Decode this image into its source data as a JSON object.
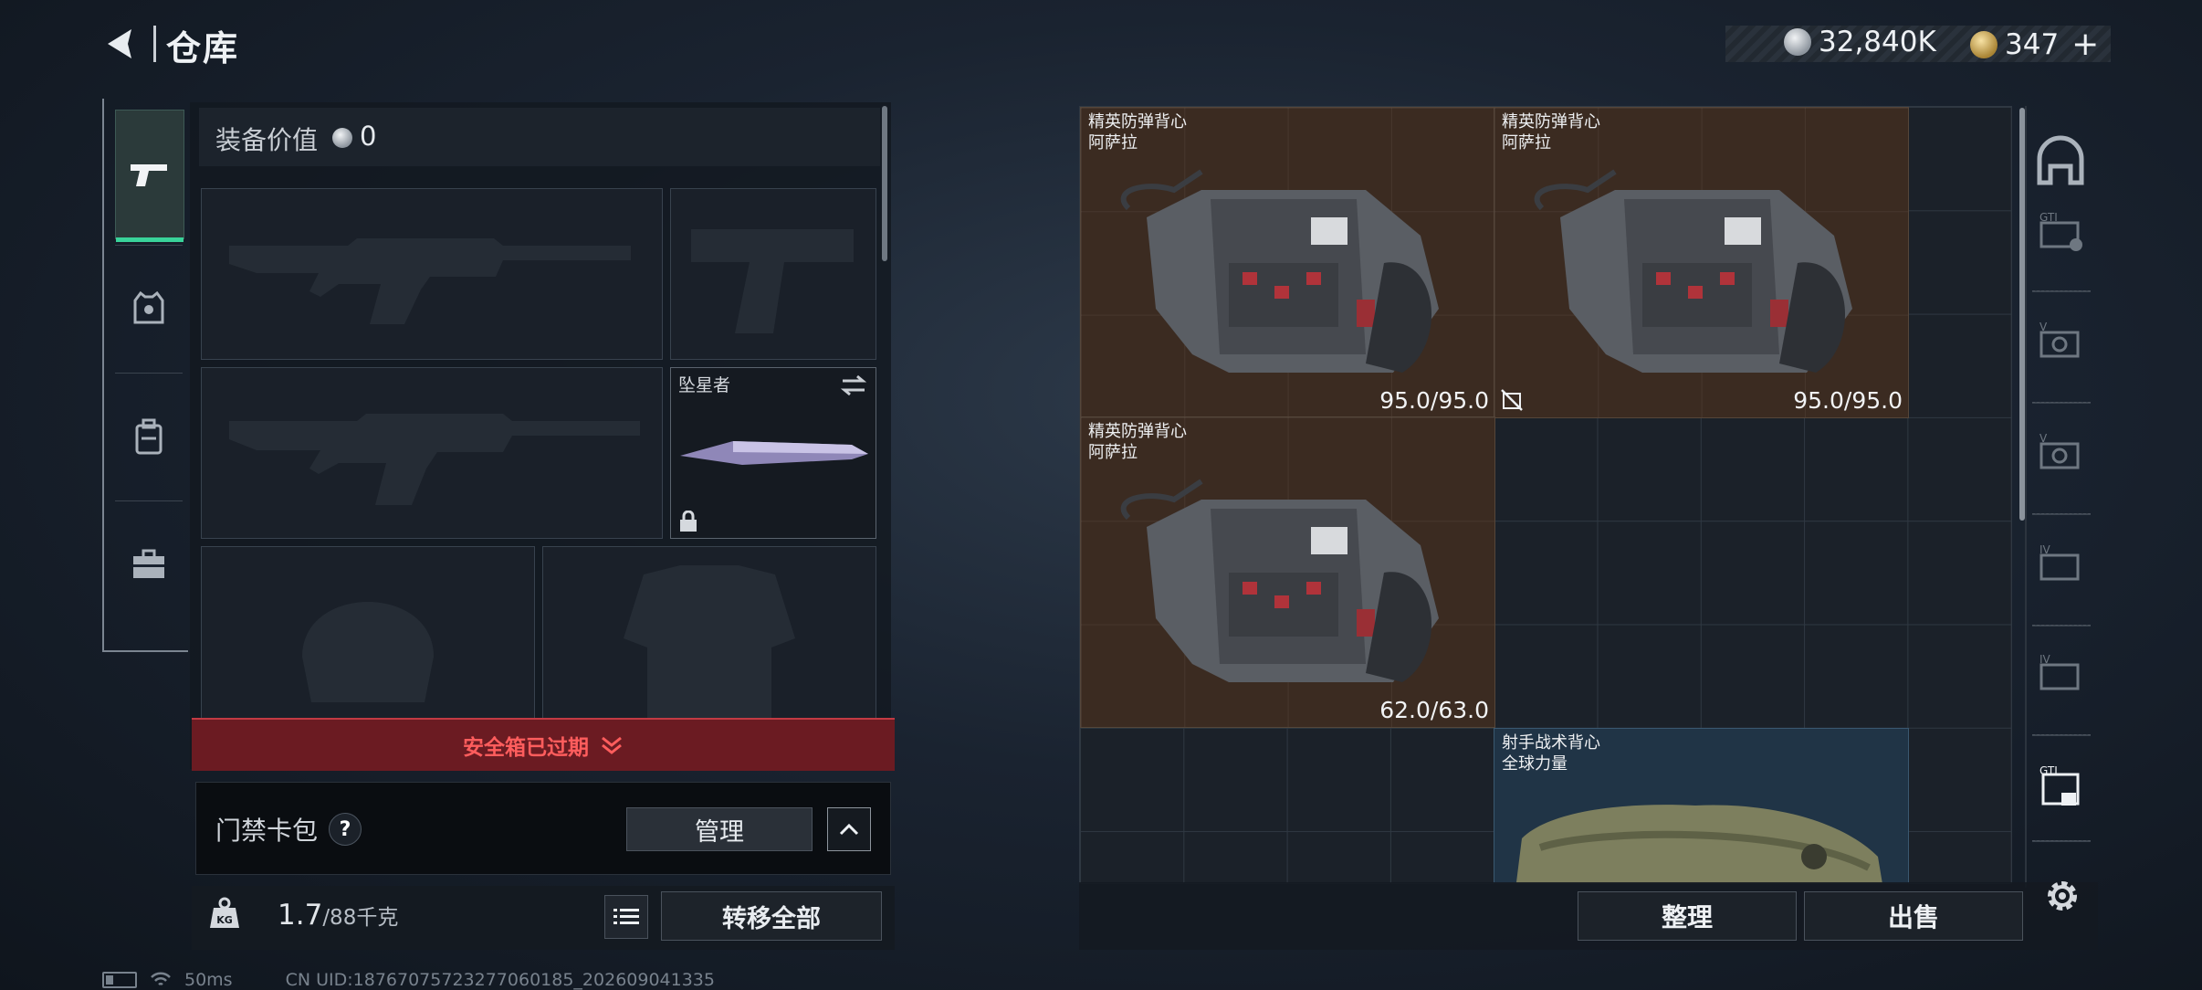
{
  "header": {
    "title": "仓库"
  },
  "currency": {
    "silver": "32,840K",
    "gold": "347"
  },
  "nav": {
    "tabs": [
      "weapons",
      "armor",
      "backpack",
      "toolbox"
    ]
  },
  "loadout": {
    "equip_value_label": "装备价值",
    "equip_value": "0",
    "melee_name": "坠星者",
    "safebox_text": "安全箱已过期",
    "keycard_label": "门禁卡包",
    "keycard_help": "?",
    "manage_label": "管理",
    "weight_current": "1.7",
    "weight_max": "/88千克",
    "transfer_label": "转移全部"
  },
  "status": {
    "ping": "50ms",
    "uid": "CN UID:18767075723277060185_202609041335"
  },
  "stash": {
    "items": [
      {
        "name": "精英防弹背心",
        "brand": "阿萨拉",
        "durability": "95.0/95.0"
      },
      {
        "name": "精英防弹背心",
        "brand": "阿萨拉",
        "durability": "95.0/95.0"
      },
      {
        "name": "精英防弹背心",
        "brand": "阿萨拉",
        "durability": "62.0/63.0"
      },
      {
        "name": "射手战术背心",
        "brand": "全球力量"
      }
    ],
    "sort_label": "整理",
    "sell_label": "出售"
  },
  "colors": {
    "accent": "#39d39a",
    "warning": "#ff5d5d",
    "item_brown": "#3b2b21",
    "item_blue": "#203446"
  }
}
